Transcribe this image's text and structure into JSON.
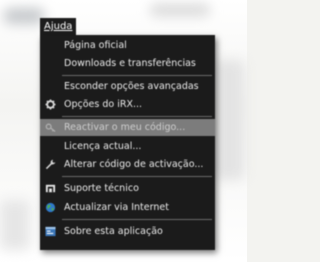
{
  "menu": {
    "title": "Ajuda",
    "items": [
      {
        "label": "Página oficial",
        "icon": null
      },
      {
        "label": "Downloads e transferências",
        "icon": null
      },
      {
        "label": "Esconder opções avançadas",
        "icon": null
      },
      {
        "label": "Opções do iRX...",
        "icon": "gear-icon"
      },
      {
        "label": "Reactivar o meu código...",
        "icon": "key-icon",
        "highlighted": true
      },
      {
        "label": "Licença actual...",
        "icon": null
      },
      {
        "label": "Alterar código de activação...",
        "icon": "wrench-icon"
      },
      {
        "label": "Suporte técnico",
        "icon": "support-icon"
      },
      {
        "label": "Actualizar via Internet",
        "icon": "globe-icon"
      },
      {
        "label": "Sobre esta aplicação",
        "icon": "app-info-icon"
      }
    ]
  }
}
